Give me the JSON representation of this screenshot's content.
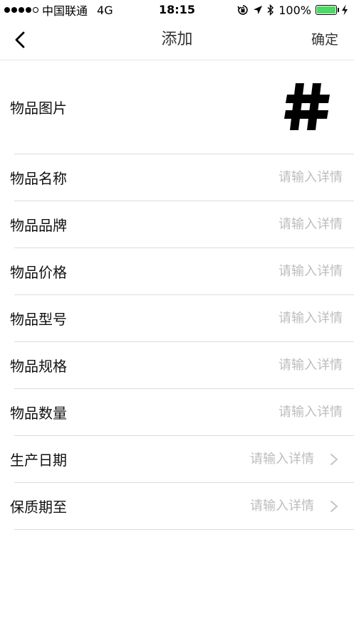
{
  "status_bar": {
    "carrier": "中国联通",
    "network": "4G",
    "time": "18:15",
    "battery_text": "100%",
    "battery_level": 1.0,
    "battery_color": "#4cd964",
    "icons": [
      "orientation-lock-icon",
      "location-arrow-icon",
      "bluetooth-icon",
      "charging-bolt-icon"
    ]
  },
  "nav": {
    "title": "添加",
    "confirm_label": "确定",
    "back_icon": "chevron-left-icon"
  },
  "form": {
    "image_label": "物品图片",
    "image_icon": "hash-icon",
    "fields": [
      {
        "key": "name",
        "label": "物品名称",
        "placeholder": "请输入详情",
        "value": ""
      },
      {
        "key": "brand",
        "label": "物品品牌",
        "placeholder": "请输入详情",
        "value": ""
      },
      {
        "key": "price",
        "label": "物品价格",
        "placeholder": "请输入详情",
        "value": ""
      },
      {
        "key": "model",
        "label": "物品型号",
        "placeholder": "请输入详情",
        "value": ""
      },
      {
        "key": "spec",
        "label": "物品规格",
        "placeholder": "请输入详情",
        "value": ""
      },
      {
        "key": "quantity",
        "label": "物品数量",
        "placeholder": "请输入详情",
        "value": ""
      }
    ],
    "date_fields": [
      {
        "key": "production_date",
        "label": "生产日期",
        "placeholder": "请输入详情",
        "value": ""
      },
      {
        "key": "expiry_date",
        "label": "保质期至",
        "placeholder": "请输入详情",
        "value": ""
      }
    ]
  }
}
